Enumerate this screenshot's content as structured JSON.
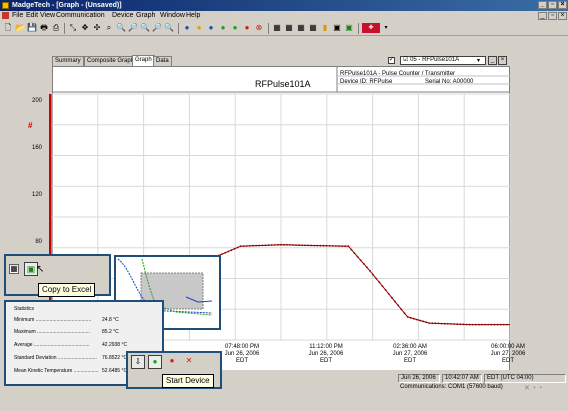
{
  "window": {
    "title": "MadgeTech - [Graph - (Unsaved)]",
    "controls": [
      "_",
      "▫",
      "×"
    ]
  },
  "menu": [
    "File",
    "Edit",
    "View",
    "Communication",
    "Device",
    "Graph",
    "Window",
    "Help"
  ],
  "tabs": [
    {
      "label": "Summary",
      "active": false
    },
    {
      "label": "Composite Graph",
      "active": false
    },
    {
      "label": "Graph",
      "active": true
    },
    {
      "label": "Data",
      "active": false
    }
  ],
  "channel_select": {
    "value": "05 - RFPulse101A",
    "checked": true
  },
  "graph_header": {
    "title": "RFPulse101A",
    "device_model": "RFPulse101A - Pulse Counter / Transmitter",
    "device_id": "Device ID: RFPulse",
    "serial": "Serial No: A00000"
  },
  "y_axis": {
    "unit": "#",
    "ticks": [
      "200",
      "160",
      "120",
      "80"
    ]
  },
  "x_axis": {
    "ticks": [
      {
        "time": "07:48:00 PM",
        "date": "Jun 26, 2006",
        "tz": "EDT"
      },
      {
        "time": "11:12:00 PM",
        "date": "Jun 26, 2006",
        "tz": "EDT"
      },
      {
        "time": "02:36:00 AM",
        "date": "Jun 27, 2006",
        "tz": "EDT"
      },
      {
        "time": "06:00:00 AM",
        "date": "Jun 27, 2006",
        "tz": "EDT"
      }
    ]
  },
  "chart_data": {
    "type": "line",
    "series": [
      {
        "values": [
          [
            0.05,
            64.5
          ],
          [
            0.2,
            65.0
          ],
          [
            0.35,
            66.0
          ],
          [
            0.45,
            72
          ],
          [
            0.55,
            84
          ],
          [
            0.62,
            95
          ],
          [
            0.7,
            101
          ],
          [
            0.85,
            102
          ],
          [
            0.95,
            101.5
          ],
          [
            1.1,
            101
          ],
          [
            1.18,
            85
          ],
          [
            1.25,
            70
          ],
          [
            1.32,
            55
          ],
          [
            1.4,
            51
          ],
          [
            1.55,
            50
          ],
          [
            1.7,
            50
          ]
        ]
      }
    ],
    "color": "#8b0000",
    "ylim": [
      40,
      200
    ]
  },
  "excel_popup": {
    "tooltip": "Copy to Excel"
  },
  "device_popup": {
    "tooltip": "Start Device"
  },
  "statistics": {
    "title": "Statistics",
    "rows": [
      {
        "label": "Minimum ........................................",
        "value": "24.8 °C"
      },
      {
        "label": "Maximum ......................................",
        "value": "85.2 °C"
      },
      {
        "label": "Average ........................................",
        "value": "42.2938 °C"
      },
      {
        "label": "Standard Deviation ............................",
        "value": "76.8522 °C"
      },
      {
        "label": "Mean Kinetic Temperature ..................",
        "value": "52.6485 °C"
      }
    ]
  },
  "status_bar": {
    "date": "Jun 26, 2006",
    "time": "10:42:07 AM",
    "utc": "EDT (UTC 04:00)",
    "communications": "Communications: COM1 (57600 baud)"
  }
}
